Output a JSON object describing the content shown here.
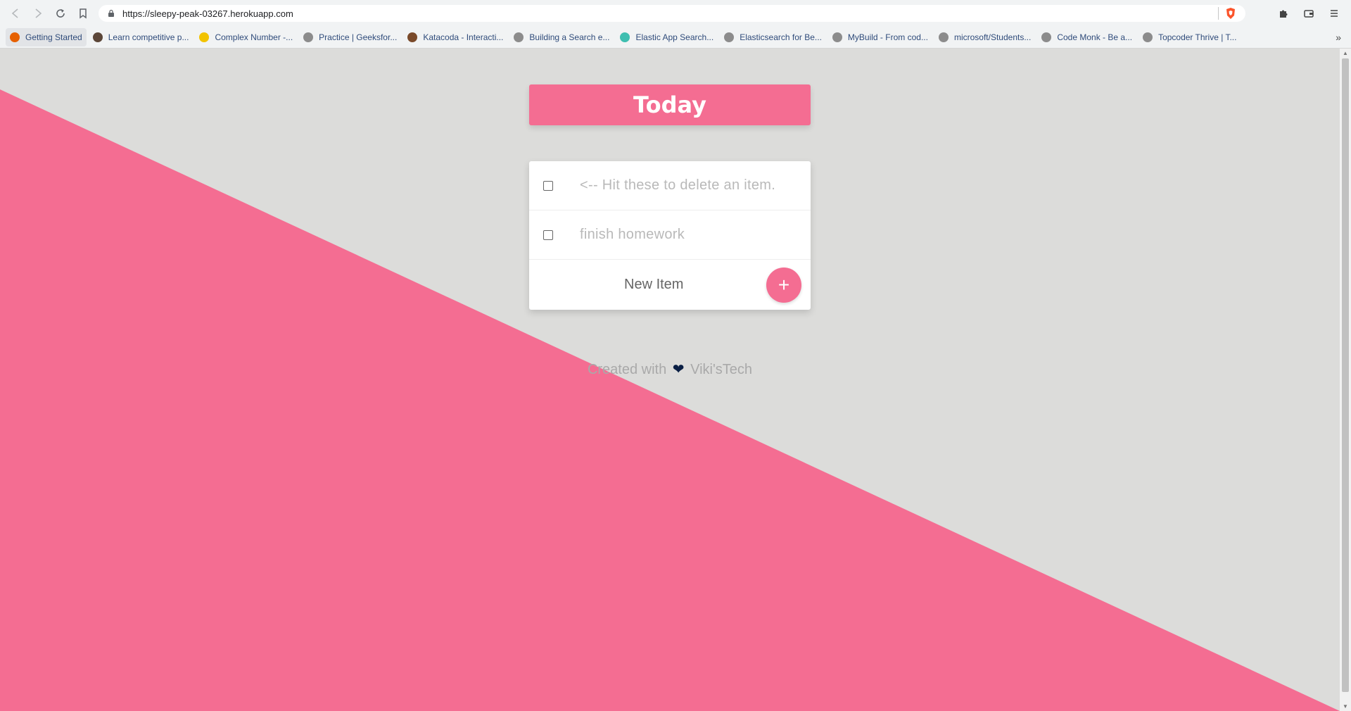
{
  "browser": {
    "url": "https://sleepy-peak-03267.herokuapp.com",
    "bookmarks": [
      {
        "label": "Getting Started",
        "active": true,
        "icon": "firefox-icon",
        "color": "#e66000"
      },
      {
        "label": "Learn competitive p...",
        "icon": "codechef-icon",
        "color": "#5b4638"
      },
      {
        "label": "Complex Number -...",
        "icon": "rocket-icon",
        "color": "#f2c300"
      },
      {
        "label": "Practice | Geeksfor...",
        "icon": "globe-icon",
        "color": "#8c8c8c"
      },
      {
        "label": "Katacoda - Interacti...",
        "icon": "katacoda-icon",
        "color": "#7a4a2a"
      },
      {
        "label": "Building a Search e...",
        "icon": "globe-icon",
        "color": "#8c8c8c"
      },
      {
        "label": "Elastic App Search...",
        "icon": "elastic-icon",
        "color": "#3ebeb0"
      },
      {
        "label": "Elasticsearch for Be...",
        "icon": "globe-icon",
        "color": "#8c8c8c"
      },
      {
        "label": "MyBuild - From cod...",
        "icon": "globe-icon",
        "color": "#8c8c8c"
      },
      {
        "label": "microsoft/Students...",
        "icon": "globe-icon",
        "color": "#8c8c8c"
      },
      {
        "label": "Code Monk - Be a...",
        "icon": "globe-icon",
        "color": "#8c8c8c"
      },
      {
        "label": "Topcoder Thrive | T...",
        "icon": "globe-icon",
        "color": "#8c8c8c"
      }
    ]
  },
  "app": {
    "title": "Today",
    "items": [
      {
        "text": "<-- Hit these to delete an item.",
        "checked": false
      },
      {
        "text": "finish homework",
        "checked": false
      }
    ],
    "new_item_placeholder": "New Item",
    "add_button": "+",
    "footer_prefix": "Created with",
    "footer_heart": "❤",
    "footer_suffix": "Viki'sTech",
    "accent_color": "#f46d92",
    "background_color": "#dcdcda"
  }
}
